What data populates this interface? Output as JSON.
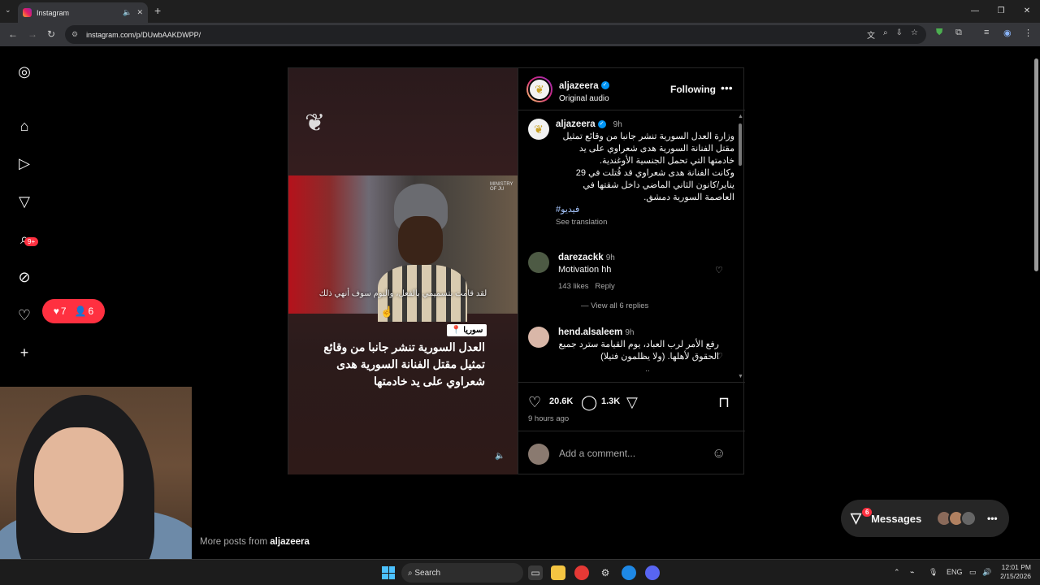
{
  "browser": {
    "tab_title": "Instagram",
    "url": "instagram.com/p/DUwbAAKDWPP/"
  },
  "sidebar": {
    "messages_badge": "9+",
    "notif_likes": "7",
    "notif_follows": "6"
  },
  "post": {
    "username": "aljazeera",
    "audio": "Original audio",
    "follow_label": "Following",
    "location_tag": "سوريا",
    "headline": "العدل السورية تنشر جانبا من وقائع تمثيل مقتل الفنانة السورية هدى شعراوي على يد خادمتها",
    "subtitle": "لقد قامت بتسميمي بالفعل، واليوم سوف أنهي ذلك",
    "ministry_label": "MINISTRY OF JU",
    "caption": {
      "username": "aljazeera",
      "time": "9h",
      "text1": "وزارة العدل السورية تنشر جانبا من وقائع تمثيل مقتل الفنانة السورية هدى شعراوي على يد خادمتها التي تحمل الجنسية الأوغندية.",
      "text2": "وكانت الفنانة هدى شعراوي قد قُتلت في 29 يناير/كانون الثاني الماضي داخل شقتها في العاصمة السورية دمشق.",
      "hashtag": "#فيديو",
      "translation": "See translation"
    },
    "comments": [
      {
        "username": "darezackk",
        "time": "9h",
        "text": "Motivation hh",
        "likes": "143 likes",
        "reply": "Reply",
        "view_replies": "View all 6 replies"
      },
      {
        "username": "hend.alsaleem",
        "time": "9h",
        "text": "رفع الأمر لرب العباد، يوم القيامة سترد جميع الحقوق لأهلها. (ولا يظلمون فتيلا)",
        "more": ".."
      }
    ],
    "likes": "20.6K",
    "comment_count": "1.3K",
    "ago": "9 hours ago",
    "add_comment_placeholder": "Add a comment..."
  },
  "more_posts": {
    "prefix": "More posts from",
    "user": "aljazeera"
  },
  "messages": {
    "label": "Messages",
    "badge": "6"
  },
  "taskbar": {
    "search_label": "Search",
    "lang": "ENG",
    "time": "12:01 PM",
    "date": "2/15/2026"
  }
}
